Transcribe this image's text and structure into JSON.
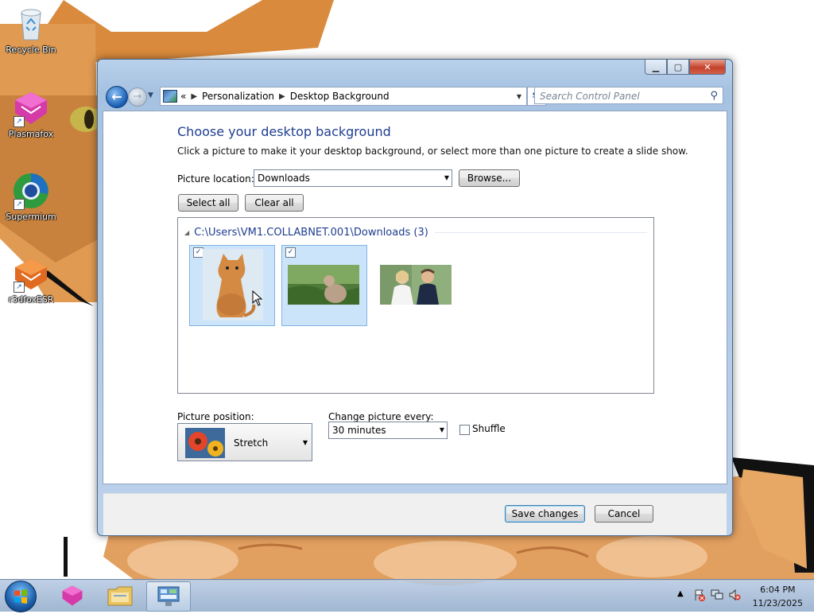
{
  "desktop": {
    "icons": [
      {
        "label": "Recycle Bin",
        "icon": "recycle-bin-icon"
      },
      {
        "label": "Plasmafox",
        "icon": "plasmafox-icon"
      },
      {
        "label": "Supermium",
        "icon": "supermium-icon"
      },
      {
        "label": "r3dfoxESR",
        "icon": "r3dfox-icon"
      }
    ]
  },
  "window": {
    "caption": {
      "minimize": "minimize",
      "maximize": "maximize",
      "close": "close"
    },
    "address": {
      "prefix": "«",
      "crumbs": [
        "Personalization",
        "Desktop Background"
      ]
    },
    "search": {
      "placeholder": "Search Control Panel"
    },
    "title": "Choose your desktop background",
    "subtitle": "Click a picture to make it your desktop background, or select more than one picture to create a slide show.",
    "picture_location": {
      "label": "Picture location:",
      "value": "Downloads"
    },
    "browse_label": "Browse...",
    "select_all_label": "Select all",
    "clear_all_label": "Clear all",
    "group": {
      "header": "C:\\Users\\VM1.COLLABNET.001\\Downloads (3)"
    },
    "pictures": [
      {
        "subject": "cat sitting",
        "selected": true,
        "checked": true
      },
      {
        "subject": "cat in grass",
        "selected": true,
        "checked": true
      },
      {
        "subject": "couple portrait",
        "selected": false,
        "checked": false
      }
    ],
    "picture_position": {
      "label": "Picture position:",
      "value": "Stretch"
    },
    "change_picture": {
      "label": "Change picture every:",
      "value": "30 minutes"
    },
    "shuffle": {
      "label": "Shuffle",
      "checked": false
    },
    "save_label": "Save changes",
    "cancel_label": "Cancel"
  },
  "taskbar": {
    "clock": {
      "time": "6:04 PM",
      "date": "11/23/2025"
    },
    "tray_icons": [
      "show-hidden-icons",
      "action-center-icon",
      "network-icon",
      "volume-muted-icon"
    ]
  }
}
